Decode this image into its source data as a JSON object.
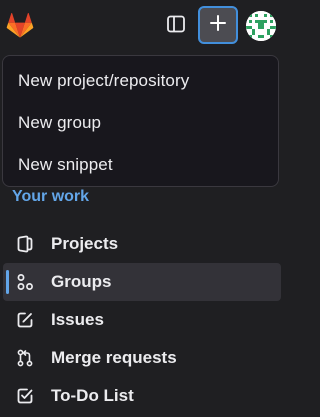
{
  "header": {
    "logo_icon": "gitlab-tanuki-logo",
    "sidebar_toggle_icon": "sidebar-icon",
    "new_button_icon": "plus-icon",
    "avatar_icon": "identicon-avatar"
  },
  "new_menu": {
    "items": [
      {
        "label": "New project/repository"
      },
      {
        "label": "New group"
      },
      {
        "label": "New snippet"
      }
    ]
  },
  "sidebar": {
    "section_title": "Your work",
    "items": [
      {
        "label": "Projects",
        "icon": "project-icon",
        "active": false
      },
      {
        "label": "Groups",
        "icon": "group-icon",
        "active": true
      },
      {
        "label": "Issues",
        "icon": "issues-icon",
        "active": false
      },
      {
        "label": "Merge requests",
        "icon": "merge-request-icon",
        "active": false
      },
      {
        "label": "To-Do List",
        "icon": "todo-icon",
        "active": false
      }
    ]
  },
  "colors": {
    "background": "#1f1f22",
    "accent": "#63a6e9",
    "logo_orange": "#e24329",
    "avatar_green": "#2da160"
  }
}
